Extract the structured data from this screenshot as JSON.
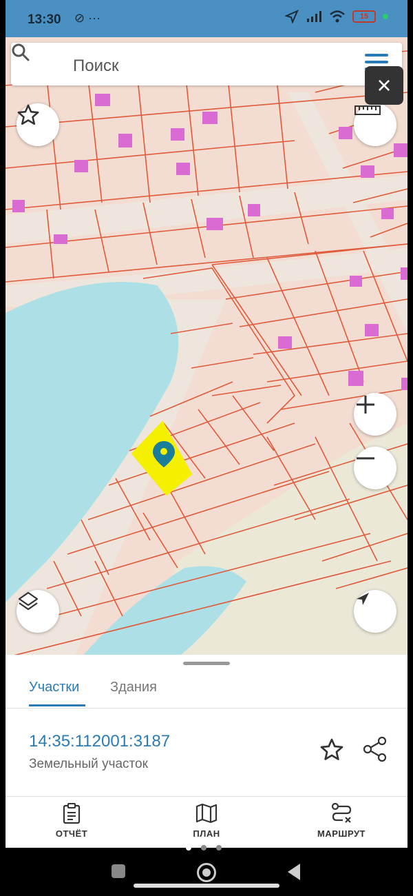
{
  "status_bar": {
    "time": "13:30",
    "left_icons": "⊘ ···",
    "battery": "15",
    "accent": "#4a90c2"
  },
  "search": {
    "placeholder": "Поиск"
  },
  "map": {
    "land_color": "#f3dcd1",
    "water_color": "#ace0e6",
    "road_color": "#eee5dc",
    "parcel_line_color": "#e05a3a",
    "building_color": "#d96bd2",
    "highlight_color": "#f5ef00",
    "pin_color": "#1a7d99"
  },
  "sheet": {
    "tab_parcels": "Участки",
    "tab_buildings": "Здания",
    "parcel_number": "14:35:112001:3187",
    "parcel_type": "Земельный участок"
  },
  "bottom_nav": {
    "report": "ОТЧЁТ",
    "plan": "ПЛАН",
    "route": "МАРШРУТ"
  },
  "icons": {
    "search": "search-icon",
    "menu": "menu-icon",
    "close": "close-icon",
    "favorite": "star-icon",
    "ruler": "ruler-icon",
    "zoom_in": "plus-icon",
    "zoom_out": "minus-icon",
    "layers": "layers-icon",
    "locate": "navigation-arrow-icon",
    "share": "share-icon",
    "report": "clipboard-icon",
    "plan": "map-icon",
    "route": "route-icon"
  }
}
